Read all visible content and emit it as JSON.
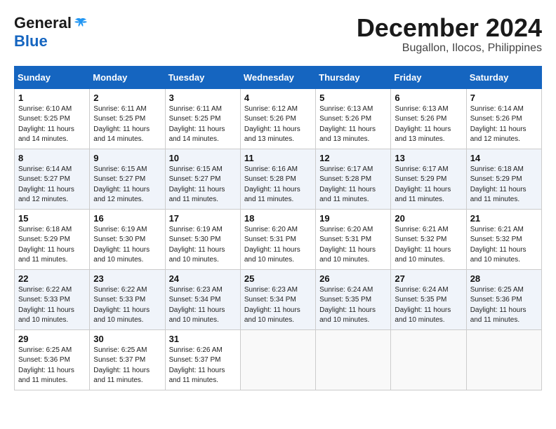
{
  "header": {
    "logo_general": "General",
    "logo_blue": "Blue",
    "month_title": "December 2024",
    "location": "Bugallon, Ilocos, Philippines"
  },
  "calendar": {
    "days_of_week": [
      "Sunday",
      "Monday",
      "Tuesday",
      "Wednesday",
      "Thursday",
      "Friday",
      "Saturday"
    ],
    "weeks": [
      [
        {
          "day": "1",
          "sunrise": "Sunrise: 6:10 AM",
          "sunset": "Sunset: 5:25 PM",
          "daylight": "Daylight: 11 hours and 14 minutes."
        },
        {
          "day": "2",
          "sunrise": "Sunrise: 6:11 AM",
          "sunset": "Sunset: 5:25 PM",
          "daylight": "Daylight: 11 hours and 14 minutes."
        },
        {
          "day": "3",
          "sunrise": "Sunrise: 6:11 AM",
          "sunset": "Sunset: 5:25 PM",
          "daylight": "Daylight: 11 hours and 14 minutes."
        },
        {
          "day": "4",
          "sunrise": "Sunrise: 6:12 AM",
          "sunset": "Sunset: 5:26 PM",
          "daylight": "Daylight: 11 hours and 13 minutes."
        },
        {
          "day": "5",
          "sunrise": "Sunrise: 6:13 AM",
          "sunset": "Sunset: 5:26 PM",
          "daylight": "Daylight: 11 hours and 13 minutes."
        },
        {
          "day": "6",
          "sunrise": "Sunrise: 6:13 AM",
          "sunset": "Sunset: 5:26 PM",
          "daylight": "Daylight: 11 hours and 13 minutes."
        },
        {
          "day": "7",
          "sunrise": "Sunrise: 6:14 AM",
          "sunset": "Sunset: 5:26 PM",
          "daylight": "Daylight: 11 hours and 12 minutes."
        }
      ],
      [
        {
          "day": "8",
          "sunrise": "Sunrise: 6:14 AM",
          "sunset": "Sunset: 5:27 PM",
          "daylight": "Daylight: 11 hours and 12 minutes."
        },
        {
          "day": "9",
          "sunrise": "Sunrise: 6:15 AM",
          "sunset": "Sunset: 5:27 PM",
          "daylight": "Daylight: 11 hours and 12 minutes."
        },
        {
          "day": "10",
          "sunrise": "Sunrise: 6:15 AM",
          "sunset": "Sunset: 5:27 PM",
          "daylight": "Daylight: 11 hours and 11 minutes."
        },
        {
          "day": "11",
          "sunrise": "Sunrise: 6:16 AM",
          "sunset": "Sunset: 5:28 PM",
          "daylight": "Daylight: 11 hours and 11 minutes."
        },
        {
          "day": "12",
          "sunrise": "Sunrise: 6:17 AM",
          "sunset": "Sunset: 5:28 PM",
          "daylight": "Daylight: 11 hours and 11 minutes."
        },
        {
          "day": "13",
          "sunrise": "Sunrise: 6:17 AM",
          "sunset": "Sunset: 5:29 PM",
          "daylight": "Daylight: 11 hours and 11 minutes."
        },
        {
          "day": "14",
          "sunrise": "Sunrise: 6:18 AM",
          "sunset": "Sunset: 5:29 PM",
          "daylight": "Daylight: 11 hours and 11 minutes."
        }
      ],
      [
        {
          "day": "15",
          "sunrise": "Sunrise: 6:18 AM",
          "sunset": "Sunset: 5:29 PM",
          "daylight": "Daylight: 11 hours and 11 minutes."
        },
        {
          "day": "16",
          "sunrise": "Sunrise: 6:19 AM",
          "sunset": "Sunset: 5:30 PM",
          "daylight": "Daylight: 11 hours and 10 minutes."
        },
        {
          "day": "17",
          "sunrise": "Sunrise: 6:19 AM",
          "sunset": "Sunset: 5:30 PM",
          "daylight": "Daylight: 11 hours and 10 minutes."
        },
        {
          "day": "18",
          "sunrise": "Sunrise: 6:20 AM",
          "sunset": "Sunset: 5:31 PM",
          "daylight": "Daylight: 11 hours and 10 minutes."
        },
        {
          "day": "19",
          "sunrise": "Sunrise: 6:20 AM",
          "sunset": "Sunset: 5:31 PM",
          "daylight": "Daylight: 11 hours and 10 minutes."
        },
        {
          "day": "20",
          "sunrise": "Sunrise: 6:21 AM",
          "sunset": "Sunset: 5:32 PM",
          "daylight": "Daylight: 11 hours and 10 minutes."
        },
        {
          "day": "21",
          "sunrise": "Sunrise: 6:21 AM",
          "sunset": "Sunset: 5:32 PM",
          "daylight": "Daylight: 11 hours and 10 minutes."
        }
      ],
      [
        {
          "day": "22",
          "sunrise": "Sunrise: 6:22 AM",
          "sunset": "Sunset: 5:33 PM",
          "daylight": "Daylight: 11 hours and 10 minutes."
        },
        {
          "day": "23",
          "sunrise": "Sunrise: 6:22 AM",
          "sunset": "Sunset: 5:33 PM",
          "daylight": "Daylight: 11 hours and 10 minutes."
        },
        {
          "day": "24",
          "sunrise": "Sunrise: 6:23 AM",
          "sunset": "Sunset: 5:34 PM",
          "daylight": "Daylight: 11 hours and 10 minutes."
        },
        {
          "day": "25",
          "sunrise": "Sunrise: 6:23 AM",
          "sunset": "Sunset: 5:34 PM",
          "daylight": "Daylight: 11 hours and 10 minutes."
        },
        {
          "day": "26",
          "sunrise": "Sunrise: 6:24 AM",
          "sunset": "Sunset: 5:35 PM",
          "daylight": "Daylight: 11 hours and 10 minutes."
        },
        {
          "day": "27",
          "sunrise": "Sunrise: 6:24 AM",
          "sunset": "Sunset: 5:35 PM",
          "daylight": "Daylight: 11 hours and 10 minutes."
        },
        {
          "day": "28",
          "sunrise": "Sunrise: 6:25 AM",
          "sunset": "Sunset: 5:36 PM",
          "daylight": "Daylight: 11 hours and 11 minutes."
        }
      ],
      [
        {
          "day": "29",
          "sunrise": "Sunrise: 6:25 AM",
          "sunset": "Sunset: 5:36 PM",
          "daylight": "Daylight: 11 hours and 11 minutes."
        },
        {
          "day": "30",
          "sunrise": "Sunrise: 6:25 AM",
          "sunset": "Sunset: 5:37 PM",
          "daylight": "Daylight: 11 hours and 11 minutes."
        },
        {
          "day": "31",
          "sunrise": "Sunrise: 6:26 AM",
          "sunset": "Sunset: 5:37 PM",
          "daylight": "Daylight: 11 hours and 11 minutes."
        },
        null,
        null,
        null,
        null
      ]
    ]
  }
}
